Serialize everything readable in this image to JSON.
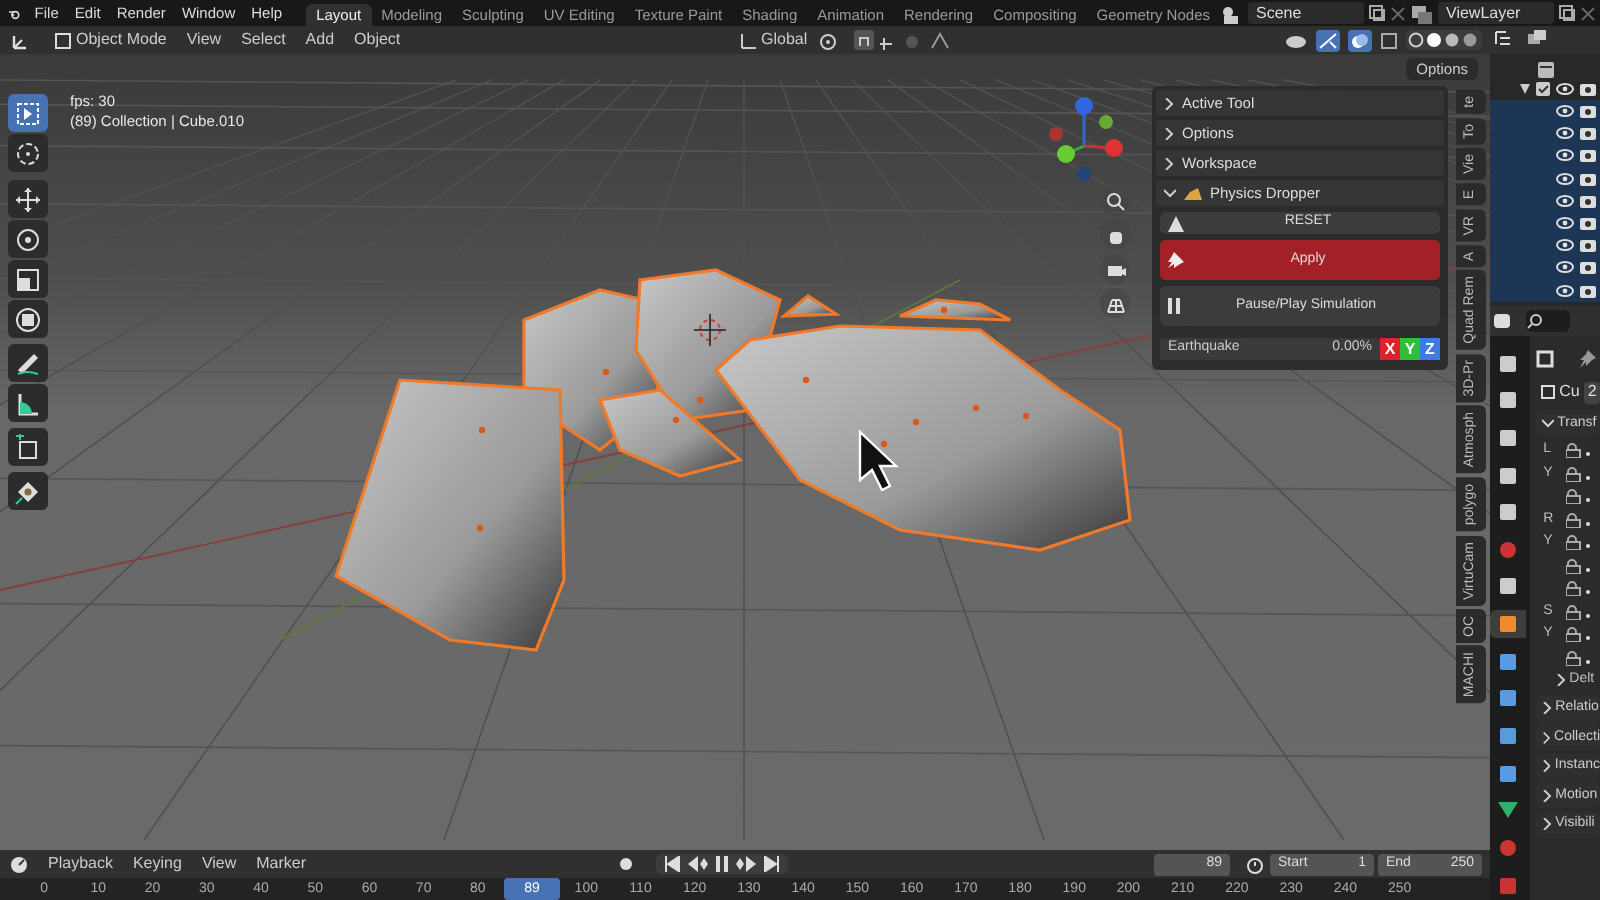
{
  "menu": [
    "File",
    "Edit",
    "Render",
    "Window",
    "Help"
  ],
  "workspaces": [
    {
      "label": "Layout",
      "selected": true
    },
    {
      "label": "Modeling",
      "selected": false
    },
    {
      "label": "Sculpting",
      "selected": false
    },
    {
      "label": "UV Editing",
      "selected": false
    },
    {
      "label": "Texture Paint",
      "selected": false
    },
    {
      "label": "Shading",
      "selected": false
    },
    {
      "label": "Animation",
      "selected": false
    },
    {
      "label": "Rendering",
      "selected": false
    },
    {
      "label": "Compositing",
      "selected": false
    },
    {
      "label": "Geometry Nodes",
      "selected": false
    }
  ],
  "scene": {
    "value": "Scene"
  },
  "view_layer": {
    "value": "ViewLayer"
  },
  "header": {
    "mode": "Object Mode",
    "menus": [
      "View",
      "Select",
      "Add",
      "Object"
    ],
    "orientation": "Global",
    "options": "Options"
  },
  "viewport": {
    "overlay": [
      "fps: 30",
      "(89) Collection | Cube.010"
    ]
  },
  "toolbar": [
    {
      "kind": "select",
      "selected": true
    },
    {
      "kind": "cursor",
      "selected": false
    },
    {
      "kind": "move",
      "selected": false
    },
    {
      "kind": "rotate",
      "selected": false
    },
    {
      "kind": "scale",
      "selected": false
    },
    {
      "kind": "transform",
      "selected": false
    },
    {
      "kind": "annotate",
      "selected": false
    },
    {
      "kind": "measure",
      "selected": false
    },
    {
      "kind": "add",
      "selected": false
    },
    {
      "kind": "dropper",
      "selected": false
    }
  ],
  "sidebar": {
    "panels": [
      {
        "title": "Active Tool",
        "expanded": false
      },
      {
        "title": "Options",
        "expanded": false
      },
      {
        "title": "Workspace",
        "expanded": false
      },
      {
        "title": "Physics Dropper",
        "expanded": true
      }
    ],
    "reset": "RESET",
    "apply": "Apply",
    "pause": "Pause/Play Simulation",
    "earthquake": {
      "label": "Earthquake",
      "value": "0.00%",
      "level": 0
    },
    "axes": [
      {
        "label": "X",
        "color": "#e0202a"
      },
      {
        "label": "Y",
        "color": "#2fbf3a"
      },
      {
        "label": "Z",
        "color": "#3d7be0"
      }
    ]
  },
  "sidebar_tabs": [
    {
      "label": "te",
      "selected": false
    },
    {
      "label": "To",
      "selected": false
    },
    {
      "label": "Vie",
      "selected": false
    },
    {
      "label": "E",
      "selected": false
    },
    {
      "label": "VR",
      "selected": false
    },
    {
      "label": "A",
      "selected": false
    },
    {
      "label": "Quad Rem",
      "selected": false
    },
    {
      "label": "3D-Pr",
      "selected": false
    },
    {
      "label": "Atmosph",
      "selected": false
    },
    {
      "label": "polygo",
      "selected": false
    },
    {
      "label": "VirtuCam",
      "selected": false
    },
    {
      "label": "OC",
      "selected": false
    },
    {
      "label": "MACHI",
      "selected": false
    }
  ],
  "outliner": {
    "rows": [
      {
        "selected": false
      },
      {
        "selected": true
      },
      {
        "selected": true
      },
      {
        "selected": true
      },
      {
        "selected": true
      },
      {
        "selected": true
      },
      {
        "selected": true
      },
      {
        "selected": true
      },
      {
        "selected": true
      },
      {
        "selected": true
      }
    ]
  },
  "properties": {
    "tabs": [
      {
        "kind": "tool",
        "selected": false
      },
      {
        "kind": "render",
        "selected": false
      },
      {
        "kind": "output",
        "selected": false
      },
      {
        "kind": "view",
        "selected": false
      },
      {
        "kind": "scene",
        "selected": false
      },
      {
        "kind": "world",
        "selected": false
      },
      {
        "kind": "collection",
        "selected": false
      },
      {
        "kind": "object",
        "selected": true
      },
      {
        "kind": "modifier",
        "selected": false
      },
      {
        "kind": "particles",
        "selected": false
      },
      {
        "kind": "physics",
        "selected": false
      },
      {
        "kind": "constraint",
        "selected": false
      },
      {
        "kind": "data",
        "selected": false
      },
      {
        "kind": "material",
        "selected": false
      },
      {
        "kind": "texture",
        "selected": false
      }
    ],
    "name": "Cu",
    "users": "2",
    "transform": "Transf",
    "rows": [
      "L",
      "Y",
      "",
      "R",
      "Y",
      "",
      "",
      "S",
      "Y",
      ""
    ],
    "delta": "Delt",
    "panels": [
      "Relatio",
      "Collecti",
      "Instanc",
      "Motion",
      "Visibili"
    ]
  },
  "timeline": {
    "menus": [
      "Playback",
      "Keying",
      "View",
      "Marker"
    ],
    "frame": "89",
    "start_label": "Start",
    "start": "1",
    "end_label": "End",
    "end": "250",
    "ticks": [
      {
        "label": "0",
        "selected": false
      },
      {
        "label": "10",
        "selected": false
      },
      {
        "label": "20",
        "selected": false
      },
      {
        "label": "30",
        "selected": false
      },
      {
        "label": "40",
        "selected": false
      },
      {
        "label": "50",
        "selected": false
      },
      {
        "label": "60",
        "selected": false
      },
      {
        "label": "70",
        "selected": false
      },
      {
        "label": "80",
        "selected": false
      },
      {
        "label": "89",
        "selected": true
      },
      {
        "label": "100",
        "selected": false
      },
      {
        "label": "110",
        "selected": false
      },
      {
        "label": "120",
        "selected": false
      },
      {
        "label": "130",
        "selected": false
      },
      {
        "label": "140",
        "selected": false
      },
      {
        "label": "150",
        "selected": false
      },
      {
        "label": "160",
        "selected": false
      },
      {
        "label": "170",
        "selected": false
      },
      {
        "label": "180",
        "selected": false
      },
      {
        "label": "190",
        "selected": false
      },
      {
        "label": "200",
        "selected": false
      },
      {
        "label": "210",
        "selected": false
      },
      {
        "label": "220",
        "selected": false
      },
      {
        "label": "230",
        "selected": false
      },
      {
        "label": "240",
        "selected": false
      },
      {
        "label": "250",
        "selected": false
      }
    ]
  }
}
